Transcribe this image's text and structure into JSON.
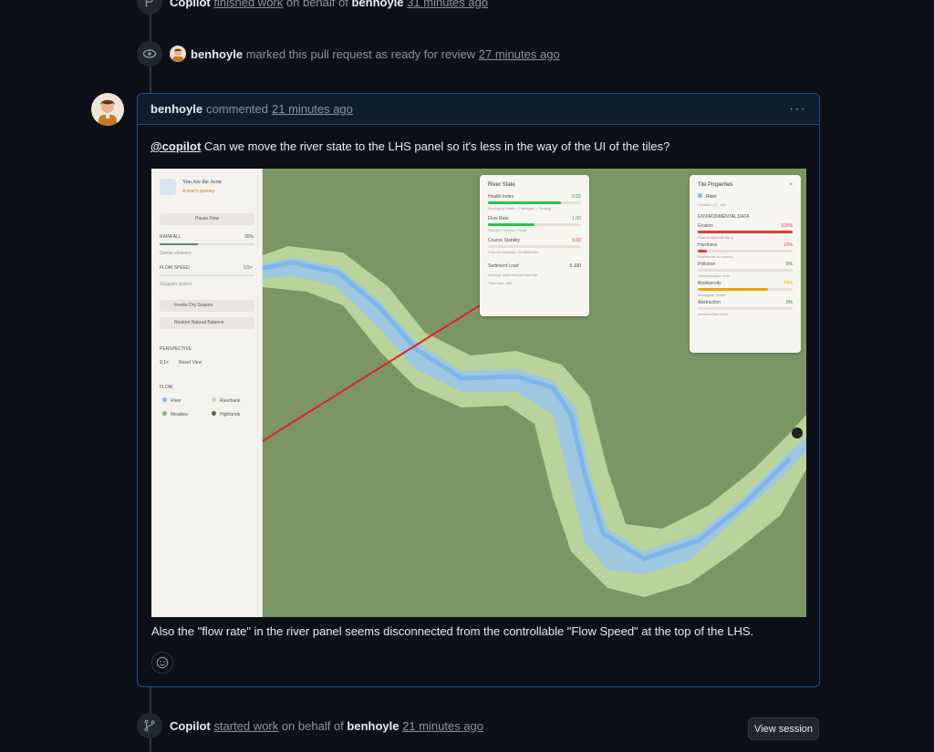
{
  "events": {
    "top": {
      "actor": "Copilot",
      "text1": "finished work",
      "text2": "on behalf of",
      "user": "benhoyle",
      "time": "31 minutes ago"
    },
    "ready": {
      "user": "benhoyle",
      "text": "marked this pull request as ready for review",
      "time": "27 minutes ago"
    },
    "started": {
      "actor": "Copilot",
      "text1": "started work",
      "text2": "on behalf of",
      "user": "benhoyle",
      "time": "21 minutes ago",
      "button": "View session"
    }
  },
  "comment": {
    "author": "benhoyle",
    "verb": "commented",
    "time": "21 minutes ago",
    "mention": "@copilot",
    "line1": "Can we move the river state to the LHS panel so it's less in the way of the UI of the tiles?",
    "line2": "Also the \"flow rate\" in the river panel seems disconnected from the controllable \"Flow Speed\" at the top of the LHS."
  },
  "screenshot": {
    "lhs": {
      "title": "You Are the Avon",
      "subtitle": "A river's journey",
      "pause": "Pause Flow",
      "rainfall": "RAINFALL",
      "rainfall_value": "30%",
      "rainfall_note": "Gentle showers",
      "flow_speed": "FLOW SPEED",
      "flow_speed_value": "0.5×",
      "flow_speed_note": "Sluggish waters",
      "dry": "Invoke Dry Season",
      "restore": "Restore Natural Balance",
      "perspective": "PERSPECTIVE",
      "zoom": "2.1×",
      "reset": "Reset View",
      "flow": "FLOW",
      "legend": [
        "River",
        "Riverbank",
        "Meadow",
        "Highlands"
      ]
    },
    "river_state": {
      "title": "River State",
      "health_label": "Health Index",
      "health_value": "0.55",
      "health_fraction": 0.78,
      "health_note": "Ecological health • Damaged • Thriving",
      "flow_label": "Flow Rate",
      "flow_value": "1.00",
      "flow_fraction": 0.5,
      "flow_note": "Stream • Torrent • Flood",
      "stability_label": "Course Stability",
      "stability_value": "0.00",
      "stability_note": "Channel integrity • Undisturbed",
      "sediment_label": "Sediment Load",
      "sediment_value": "0.100",
      "sediment_note": "Average sediment per river tile",
      "total": "Total river: 462"
    },
    "tile": {
      "title": "Tile Properties",
      "type": "River",
      "location": "Location (47, 46)",
      "env": "ENVIRONMENTAL DATA",
      "rows": [
        {
          "label": "Erosion",
          "value": "100%",
          "note": "Flow-eroded the tile is",
          "color": "#e53935",
          "fraction": 1.0
        },
        {
          "label": "Hardness",
          "value": "10%",
          "note": "Resistance to erosion",
          "color": "#e53935",
          "fraction": 0.1
        },
        {
          "label": "Pollution",
          "value": "0%",
          "note": "Contamination level",
          "color": "#2e7d32",
          "fraction": 0.0
        },
        {
          "label": "Biodiversity",
          "value": "74%",
          "note": "Ecological health",
          "color": "#f0a500",
          "fraction": 0.74
        },
        {
          "label": "Abstraction",
          "value": "0%",
          "note": "Infrastructure level",
          "color": "#2e7d32",
          "fraction": 0.0
        }
      ]
    }
  }
}
